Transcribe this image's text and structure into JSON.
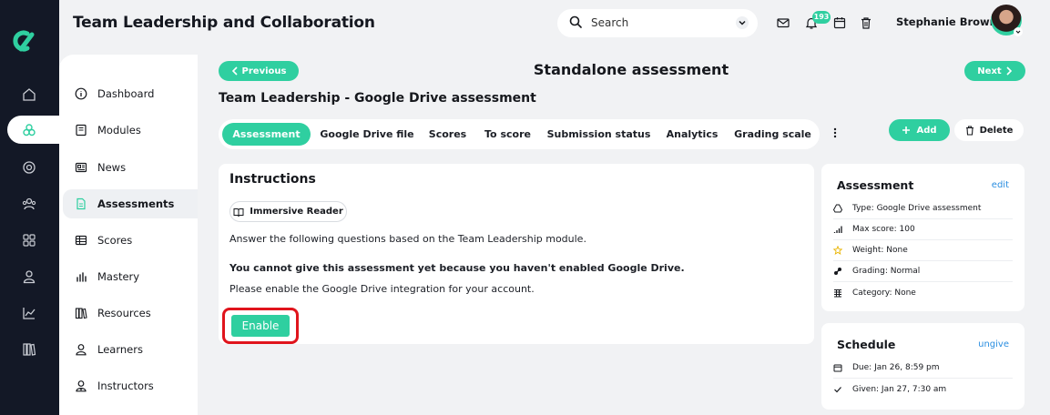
{
  "app": {
    "title": "Team Leadership and Collaboration"
  },
  "header": {
    "search_placeholder": "Search",
    "notification_count": "193",
    "user_name": "Stephanie Brown"
  },
  "sidebar": {
    "items": [
      {
        "label": "Dashboard",
        "icon": "info-circle-icon"
      },
      {
        "label": "Modules",
        "icon": "book-icon"
      },
      {
        "label": "News",
        "icon": "newspaper-icon"
      },
      {
        "label": "Assessments",
        "icon": "document-icon",
        "active": true
      },
      {
        "label": "Scores",
        "icon": "table-icon"
      },
      {
        "label": "Mastery",
        "icon": "bar-chart-icon"
      },
      {
        "label": "Resources",
        "icon": "library-icon"
      },
      {
        "label": "Learners",
        "icon": "user-icon"
      },
      {
        "label": "Instructors",
        "icon": "instructor-icon"
      }
    ]
  },
  "page": {
    "prev_label": "Previous",
    "next_label": "Next",
    "title": "Standalone assessment",
    "subtitle": "Team Leadership - Google Drive assessment"
  },
  "tabs": [
    "Assessment",
    "Google Drive file",
    "Scores",
    "To score",
    "Submission status",
    "Analytics",
    "Grading scale"
  ],
  "actions": {
    "add_label": "Add",
    "delete_label": "Delete"
  },
  "instructions": {
    "title": "Instructions",
    "reader_label": "Immersive Reader",
    "text": "Answer the following questions based on the Team Leadership module.",
    "warning": "You cannot give this assessment yet because you haven't enabled Google Drive.",
    "hint": "Please enable the Google Drive integration for your account.",
    "enable_label": "Enable"
  },
  "assessment_card": {
    "title": "Assessment",
    "link": "edit",
    "rows": [
      "Type: Google Drive assessment",
      "Max score: 100",
      "Weight: None",
      "Grading: Normal",
      "Category: None"
    ]
  },
  "schedule_card": {
    "title": "Schedule",
    "link": "ungive",
    "rows": [
      "Due: Jan 26, 8:59 pm",
      "Given: Jan 27, 7:30 am"
    ]
  },
  "colors": {
    "accent": "#2fcfa0",
    "rail": "#131826",
    "highlight": "#e0141c",
    "link": "#2a8ee0"
  }
}
